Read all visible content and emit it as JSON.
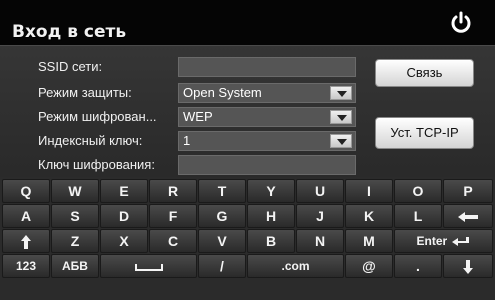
{
  "window": {
    "title": "Вход в сеть",
    "power_icon": "power-icon"
  },
  "form": {
    "ssid_label": "SSID сети:",
    "ssid_value": "",
    "security_label": "Режим защиты:",
    "security_value": "Open System",
    "encryption_label": "Режим шифрован...",
    "encryption_value": "WEP",
    "key_index_label": "Индексный ключ:",
    "key_index_value": "1",
    "key_label": "Ключ шифрования:",
    "key_value": ""
  },
  "buttons": {
    "connect": "Связь",
    "tcpip": "Уст. TCP-IP"
  },
  "keyboard": {
    "row1": [
      "Q",
      "W",
      "E",
      "R",
      "T",
      "Y",
      "U",
      "I",
      "O",
      "P"
    ],
    "row2": [
      "A",
      "S",
      "D",
      "F",
      "G",
      "H",
      "J",
      "K",
      "L"
    ],
    "row3": [
      "Z",
      "X",
      "C",
      "V",
      "B",
      "N",
      "M"
    ],
    "enter": "Enter",
    "numbers": "123",
    "cyrillic": "АБВ",
    "slash": "/",
    "dotcom": ".com",
    "at": "@",
    "dot": "."
  }
}
